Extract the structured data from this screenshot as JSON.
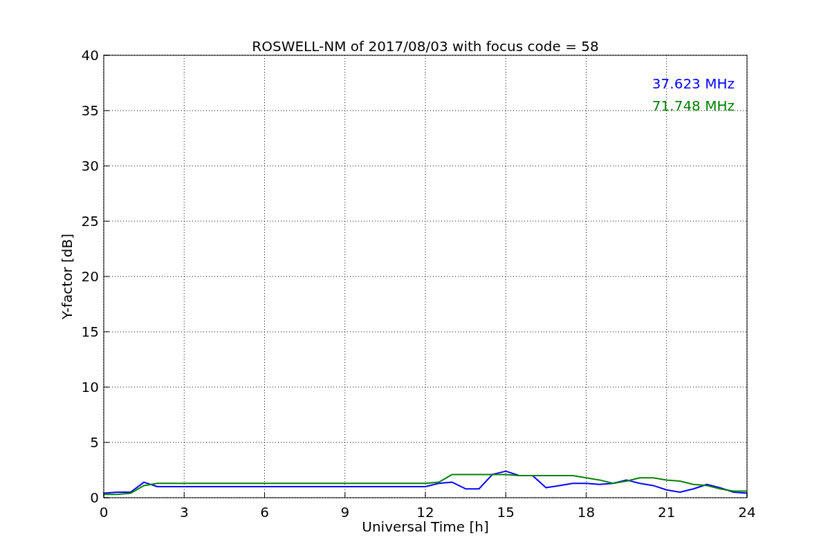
{
  "chart_data": {
    "type": "line",
    "title": "ROSWELL-NM of 2017/08/03 with focus code = 58",
    "xlabel": "Universal Time [h]",
    "ylabel": "Y-factor [dB]",
    "x": [
      0,
      0.5,
      1,
      1.5,
      2,
      12,
      12.5,
      13,
      13.5,
      14,
      14.5,
      15,
      15.5,
      16,
      16.5,
      17,
      17.5,
      18,
      18.5,
      19,
      19.5,
      20,
      20.5,
      21,
      21.5,
      22,
      22.5,
      23,
      23.5,
      24
    ],
    "series": [
      {
        "name": "37.623 MHz",
        "color": "#0000ff",
        "values": [
          0.4,
          0.5,
          0.5,
          1.4,
          1.0,
          1.0,
          1.3,
          1.4,
          0.8,
          0.8,
          2.1,
          2.4,
          2.0,
          2.0,
          0.9,
          1.1,
          1.3,
          1.3,
          1.2,
          1.3,
          1.6,
          1.3,
          1.1,
          0.7,
          0.5,
          0.8,
          1.2,
          0.9,
          0.5,
          0.4
        ]
      },
      {
        "name": "71.748 MHz",
        "color": "#008000",
        "values": [
          0.3,
          0.3,
          0.4,
          1.1,
          1.3,
          1.3,
          1.4,
          2.1,
          2.1,
          2.1,
          2.1,
          2.1,
          2.0,
          2.0,
          2.0,
          2.0,
          2.0,
          1.8,
          1.6,
          1.3,
          1.5,
          1.8,
          1.8,
          1.6,
          1.5,
          1.2,
          1.1,
          0.8,
          0.6,
          0.6
        ]
      }
    ],
    "xlim": [
      0,
      24
    ],
    "ylim": [
      0,
      40
    ],
    "xticks": [
      0,
      3,
      6,
      9,
      12,
      15,
      18,
      21,
      24
    ],
    "yticks": [
      0,
      5,
      10,
      15,
      20,
      25,
      30,
      35,
      40
    ],
    "grid": true
  }
}
